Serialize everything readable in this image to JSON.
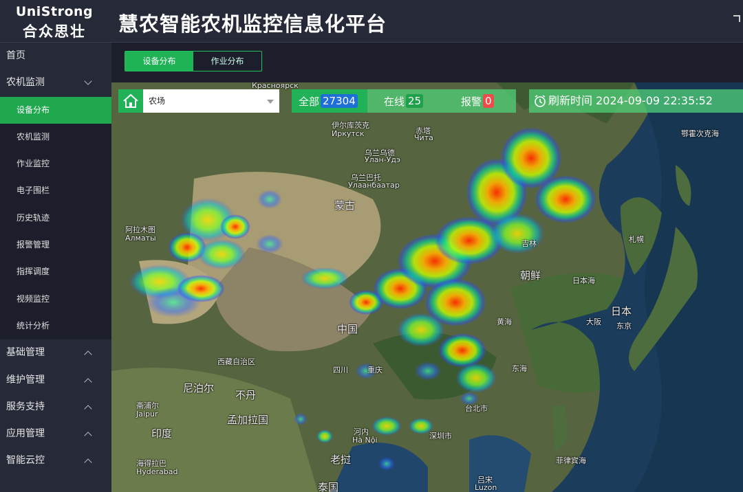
{
  "header": {
    "logo_en": "UniStrong",
    "logo_cn": "合众思壮",
    "title": "慧农智能农机监控信息化平台"
  },
  "sidebar": {
    "items": [
      {
        "label": "首页"
      },
      {
        "label": "农机监测",
        "expanded": true,
        "children": [
          {
            "label": "设备分布",
            "active": true
          },
          {
            "label": "农机监测"
          },
          {
            "label": "作业监控"
          },
          {
            "label": "电子围栏"
          },
          {
            "label": "历史轨迹"
          },
          {
            "label": "报警管理"
          },
          {
            "label": "指挥调度"
          },
          {
            "label": "视频监控"
          },
          {
            "label": "统计分析"
          }
        ]
      },
      {
        "label": "基础管理",
        "expanded": false
      },
      {
        "label": "维护管理",
        "expanded": false
      },
      {
        "label": "服务支持",
        "expanded": false
      },
      {
        "label": "应用管理",
        "expanded": false
      },
      {
        "label": "智能云控",
        "expanded": false
      }
    ]
  },
  "tabs": [
    {
      "label": "设备分布",
      "active": true
    },
    {
      "label": "作业分布",
      "active": false
    }
  ],
  "filter": {
    "farm_value": "农场",
    "home_icon": "home-icon"
  },
  "counts": {
    "all_label": "全部",
    "all_value": "27304",
    "online_label": "在线",
    "online_value": "25",
    "alarm_label": "报警",
    "alarm_value": "0"
  },
  "refresh": {
    "label": "刷新时间",
    "time": "2024-09-09 22:35:52",
    "icon": "alarm-clock-icon"
  },
  "map": {
    "labels": [
      "Красноярск",
      "伊尔库茨克",
      "Иркутск",
      "赤塔",
      "Чита",
      "乌兰乌德",
      "Улан-Удэ",
      "乌兰巴托",
      "Улаанбаатар",
      "蒙古",
      "阿拉木图",
      "Алматы",
      "中国",
      "四川",
      "重庆",
      "西藏自治区",
      "尼泊尔",
      "不丹",
      "孟加拉国",
      "印度",
      "斋浦尔",
      "Jaipur",
      "海得拉巴",
      "Hyderabad",
      "老挝",
      "河内",
      "Hà Nội",
      "泰国",
      "台北市",
      "深圳市",
      "东海",
      "黄海",
      "朝鲜",
      "日本海",
      "日本",
      "东京",
      "大阪",
      "札幌",
      "吉林",
      "鄂霍次克海",
      "菲律宾海",
      "吕宋",
      "Luzon"
    ],
    "colors": {
      "accent": "#20b356",
      "badge_all": "#1f6fd8",
      "badge_alarm": "#ee4b4b"
    }
  }
}
